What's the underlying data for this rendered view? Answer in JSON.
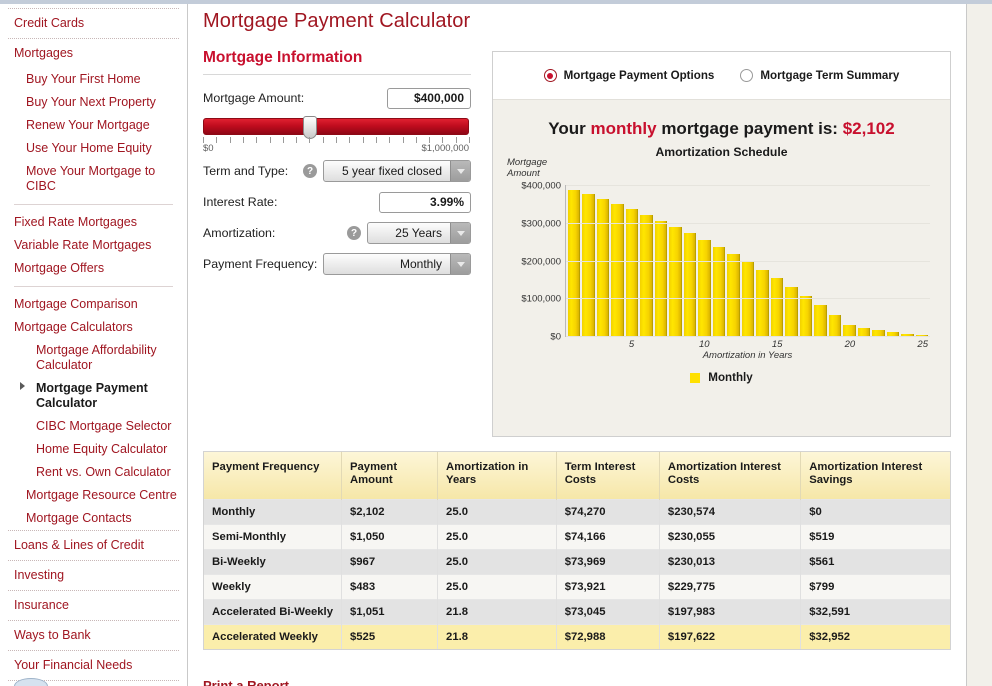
{
  "sidebar": {
    "groups": [
      {
        "type": "sep"
      },
      {
        "type": "item",
        "label": "Credit Cards",
        "level": 1,
        "section": true
      },
      {
        "type": "sep"
      },
      {
        "type": "item",
        "label": "Mortgages",
        "level": 1,
        "section": true
      },
      {
        "type": "item",
        "label": "Buy Your First Home",
        "level": 2
      },
      {
        "type": "item",
        "label": "Buy Your Next Property",
        "level": 2
      },
      {
        "type": "item",
        "label": "Renew Your Mortgage",
        "level": 2
      },
      {
        "type": "item",
        "label": "Use Your Home Equity",
        "level": 2
      },
      {
        "type": "item",
        "label": "Move Your Mortgage to CIBC",
        "level": 2
      },
      {
        "type": "rule"
      },
      {
        "type": "item",
        "label": "Fixed Rate Mortgages",
        "level": 1
      },
      {
        "type": "item",
        "label": "Variable Rate Mortgages",
        "level": 1
      },
      {
        "type": "item",
        "label": "Mortgage Offers",
        "level": 1
      },
      {
        "type": "rule"
      },
      {
        "type": "item",
        "label": "Mortgage Comparison",
        "level": 1
      },
      {
        "type": "item",
        "label": "Mortgage Calculators",
        "level": 1
      },
      {
        "type": "item",
        "label": "Mortgage Affordability Calculator",
        "level": 3
      },
      {
        "type": "item",
        "label": "Mortgage Payment Calculator",
        "level": 3,
        "current": true
      },
      {
        "type": "item",
        "label": "CIBC Mortgage Selector",
        "level": 3
      },
      {
        "type": "item",
        "label": "Home Equity Calculator",
        "level": 3
      },
      {
        "type": "item",
        "label": "Rent vs. Own Calculator",
        "level": 3
      },
      {
        "type": "item",
        "label": "Mortgage Resource Centre",
        "level": 2
      },
      {
        "type": "item",
        "label": "Mortgage Contacts",
        "level": 2
      },
      {
        "type": "sep"
      },
      {
        "type": "item",
        "label": "Loans & Lines of Credit",
        "level": 1,
        "section": true
      },
      {
        "type": "sep"
      },
      {
        "type": "item",
        "label": "Investing",
        "level": 1,
        "section": true
      },
      {
        "type": "sep"
      },
      {
        "type": "item",
        "label": "Insurance",
        "level": 1,
        "section": true
      },
      {
        "type": "sep"
      },
      {
        "type": "item",
        "label": "Ways to Bank",
        "level": 1,
        "section": true
      },
      {
        "type": "sep"
      },
      {
        "type": "item",
        "label": "Your Financial Needs",
        "level": 1,
        "section": true
      },
      {
        "type": "sep"
      }
    ]
  },
  "page": {
    "title": "Mortgage Payment Calculator",
    "print_report_label": "Print a Report"
  },
  "form": {
    "section_title": "Mortgage Information",
    "mortgage_amount": {
      "label": "Mortgage Amount:",
      "value": "$400,000",
      "slider_min_label": "$0",
      "slider_max_label": "$1,000,000",
      "slider_position_percent": 40,
      "tick_count": 21
    },
    "term_and_type": {
      "label": "Term and Type:",
      "value": "5 year fixed closed",
      "help": "?"
    },
    "interest_rate": {
      "label": "Interest Rate:",
      "value": "3.99%"
    },
    "amortization": {
      "label": "Amortization:",
      "value": "25 Years",
      "help": "?"
    },
    "payment_frequency": {
      "label": "Payment Frequency:",
      "value": "Monthly"
    }
  },
  "results_panel": {
    "options": [
      {
        "label": "Mortgage Payment Options",
        "selected": true
      },
      {
        "label": "Mortgage Term Summary",
        "selected": false
      }
    ],
    "headline_prefix": "Your ",
    "headline_emphasis": "monthly",
    "headline_middle": " mortgage payment is: ",
    "headline_amount": "$2,102",
    "accent_color": "#c8102e"
  },
  "chart_data": {
    "type": "bar",
    "title": "Amortization Schedule",
    "xlabel": "Amortization in Years",
    "ylabel": "Mortgage Amount",
    "ylim": [
      0,
      400000
    ],
    "y_ticks": [
      0,
      100000,
      200000,
      300000,
      400000
    ],
    "y_tick_labels": [
      "$0",
      "$100,000",
      "$200,000",
      "$300,000",
      "$400,000"
    ],
    "x_ticks": [
      5,
      10,
      15,
      20,
      25
    ],
    "x_tick_labels": [
      "5",
      "10",
      "15",
      "20",
      "25"
    ],
    "grid": true,
    "legend": [
      {
        "name": "Monthly",
        "color": "#ffe000"
      }
    ],
    "legend_position": "bottom",
    "bar_color": "#ffe000",
    "categories": [
      1,
      2,
      3,
      4,
      5,
      6,
      7,
      8,
      9,
      10,
      11,
      12,
      13,
      14,
      15,
      16,
      17,
      18,
      19,
      20,
      21,
      22,
      23,
      24,
      25
    ],
    "series": [
      {
        "name": "Monthly",
        "values": [
          388000,
          376000,
          363000,
          350000,
          336000,
          321000,
          306000,
          290000,
          273000,
          255000,
          237000,
          217000,
          197000,
          176000,
          154000,
          131000,
          107000,
          82000,
          56000,
          29000,
          22000,
          16000,
          11000,
          6000,
          2000
        ]
      }
    ]
  },
  "table": {
    "columns": [
      "Payment Frequency",
      "Payment Amount",
      "Amortization in Years",
      "Term Interest Costs",
      "Amortization Interest Costs",
      "Amortization Interest Savings"
    ],
    "rows": [
      {
        "highlight": false,
        "cells": [
          "Monthly",
          "$2,102",
          "25.0",
          "$74,270",
          "$230,574",
          "$0"
        ]
      },
      {
        "highlight": false,
        "cells": [
          "Semi-Monthly",
          "$1,050",
          "25.0",
          "$74,166",
          "$230,055",
          "$519"
        ]
      },
      {
        "highlight": false,
        "cells": [
          "Bi-Weekly",
          "$967",
          "25.0",
          "$73,969",
          "$230,013",
          "$561"
        ]
      },
      {
        "highlight": false,
        "cells": [
          "Weekly",
          "$483",
          "25.0",
          "$73,921",
          "$229,775",
          "$799"
        ]
      },
      {
        "highlight": false,
        "cells": [
          "Accelerated Bi-Weekly",
          "$1,051",
          "21.8",
          "$73,045",
          "$197,983",
          "$32,591"
        ]
      },
      {
        "highlight": true,
        "cells": [
          "Accelerated Weekly",
          "$525",
          "21.8",
          "$72,988",
          "$197,622",
          "$32,952"
        ]
      }
    ]
  }
}
